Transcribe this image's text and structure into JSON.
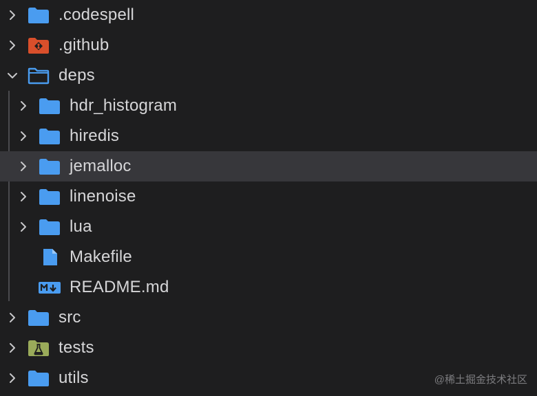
{
  "explorer": {
    "items": [
      {
        "label": ".codespell",
        "level": 0,
        "kind": "folder",
        "chevron": "right",
        "icon": "folder-icon",
        "color": "#4a9cf0"
      },
      {
        "label": ".github",
        "level": 0,
        "kind": "folder",
        "chevron": "right",
        "icon": "github-folder-icon",
        "color": "#d94f2b"
      },
      {
        "label": "deps",
        "level": 0,
        "kind": "folder",
        "chevron": "down",
        "icon": "open-folder-icon",
        "color": "#4a9cf0"
      },
      {
        "label": "hdr_histogram",
        "level": 1,
        "kind": "folder",
        "chevron": "right",
        "icon": "folder-icon",
        "color": "#4a9cf0"
      },
      {
        "label": "hiredis",
        "level": 1,
        "kind": "folder",
        "chevron": "right",
        "icon": "folder-icon",
        "color": "#4a9cf0"
      },
      {
        "label": "jemalloc",
        "level": 1,
        "kind": "folder",
        "chevron": "right",
        "icon": "folder-icon",
        "color": "#4a9cf0",
        "selected": true
      },
      {
        "label": "linenoise",
        "level": 1,
        "kind": "folder",
        "chevron": "right",
        "icon": "folder-icon",
        "color": "#4a9cf0"
      },
      {
        "label": "lua",
        "level": 1,
        "kind": "folder",
        "chevron": "right",
        "icon": "folder-icon",
        "color": "#4a9cf0"
      },
      {
        "label": "Makefile",
        "level": 1,
        "kind": "file",
        "chevron": "none",
        "icon": "file-icon",
        "color": "#4a9cf0"
      },
      {
        "label": "README.md",
        "level": 1,
        "kind": "file",
        "chevron": "none",
        "icon": "markdown-icon",
        "color": "#4a9cf0"
      },
      {
        "label": "src",
        "level": 0,
        "kind": "folder",
        "chevron": "right",
        "icon": "folder-icon",
        "color": "#4a9cf0"
      },
      {
        "label": "tests",
        "level": 0,
        "kind": "folder",
        "chevron": "right",
        "icon": "test-folder-icon",
        "color": "#9aab5a"
      },
      {
        "label": "utils",
        "level": 0,
        "kind": "folder",
        "chevron": "right",
        "icon": "folder-icon",
        "color": "#4a9cf0"
      }
    ]
  },
  "watermark": "@稀土掘金技术社区",
  "colors": {
    "background": "#1e1e1f",
    "selection": "#37373b",
    "text": "#d6d6d8"
  }
}
